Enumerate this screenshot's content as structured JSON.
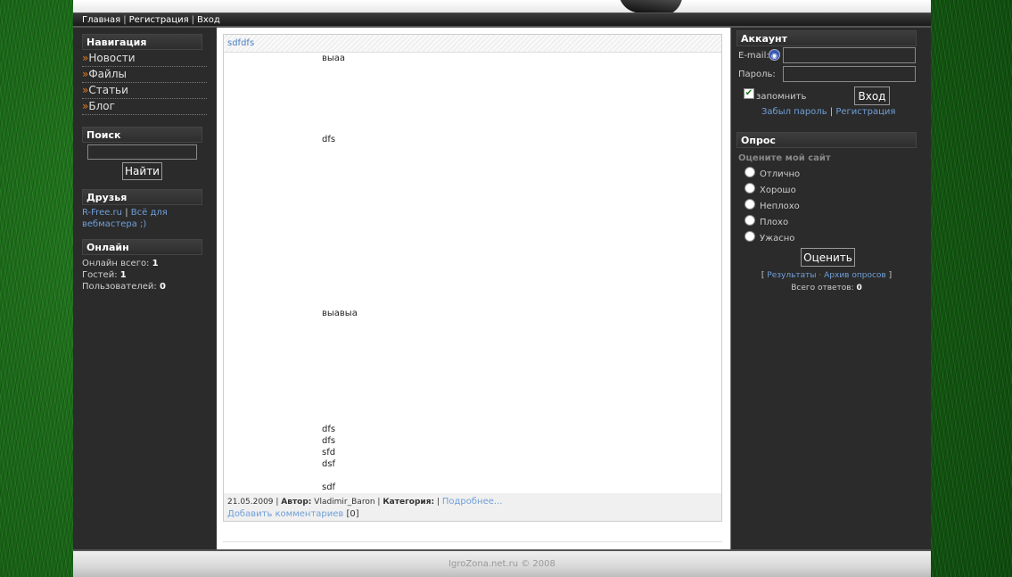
{
  "topnav": {
    "home": "Главная",
    "register": "Регистрация",
    "login": "Вход",
    "sep": "|"
  },
  "left": {
    "nav_title": "Навигация",
    "nav_items": [
      "Новости",
      "Файлы",
      "Статьи",
      "Блог"
    ],
    "raquo": "»",
    "search_title": "Поиск",
    "search_value": "",
    "search_button": "Найти",
    "friends_title": "Друзья",
    "friends_link1": "R-Free.ru",
    "friends_sep": "|",
    "friends_link2": "Всё для вебмастера ;)",
    "online_title": "Онлайн",
    "online_total_label": "Онлайн всего:",
    "online_total": "1",
    "guests_label": "Гостей:",
    "guests": "1",
    "users_label": "Пользователей:",
    "users": "0"
  },
  "post": {
    "title": "sdfdfs",
    "lines": [
      "выаа",
      "dfs",
      "выавыа",
      "dfs",
      "dfs",
      "sfd",
      "dsf",
      "sdf"
    ],
    "date": "21.05.2009",
    "author_label": "Автор:",
    "author": "Vladimir_Baron",
    "category_label": "Категория:",
    "more": "Подробнее...",
    "comments_link": "Добавить комментариев",
    "comments_count": "[0]"
  },
  "account": {
    "title": "Аккаунт",
    "email_label": "E-mail:",
    "password_label": "Пароль:",
    "remember_label": "запомнить",
    "login_button": "Вход",
    "forgot": "Забыл пароль",
    "register": "Регистрация",
    "sep": "|"
  },
  "poll": {
    "title": "Опрос",
    "question": "Оцените мой сайт",
    "options": [
      "Отлично",
      "Хорошо",
      "Неплохо",
      "Плохо",
      "Ужасно"
    ],
    "vote_button": "Оценить",
    "results": "Результаты",
    "archive": "Архив опросов",
    "dot": "·",
    "lbr": "[",
    "rbr": "]",
    "total_label": "Всего ответов:",
    "total": "0"
  },
  "footer": {
    "copyright": "IgroZona.net.ru © 2008"
  }
}
